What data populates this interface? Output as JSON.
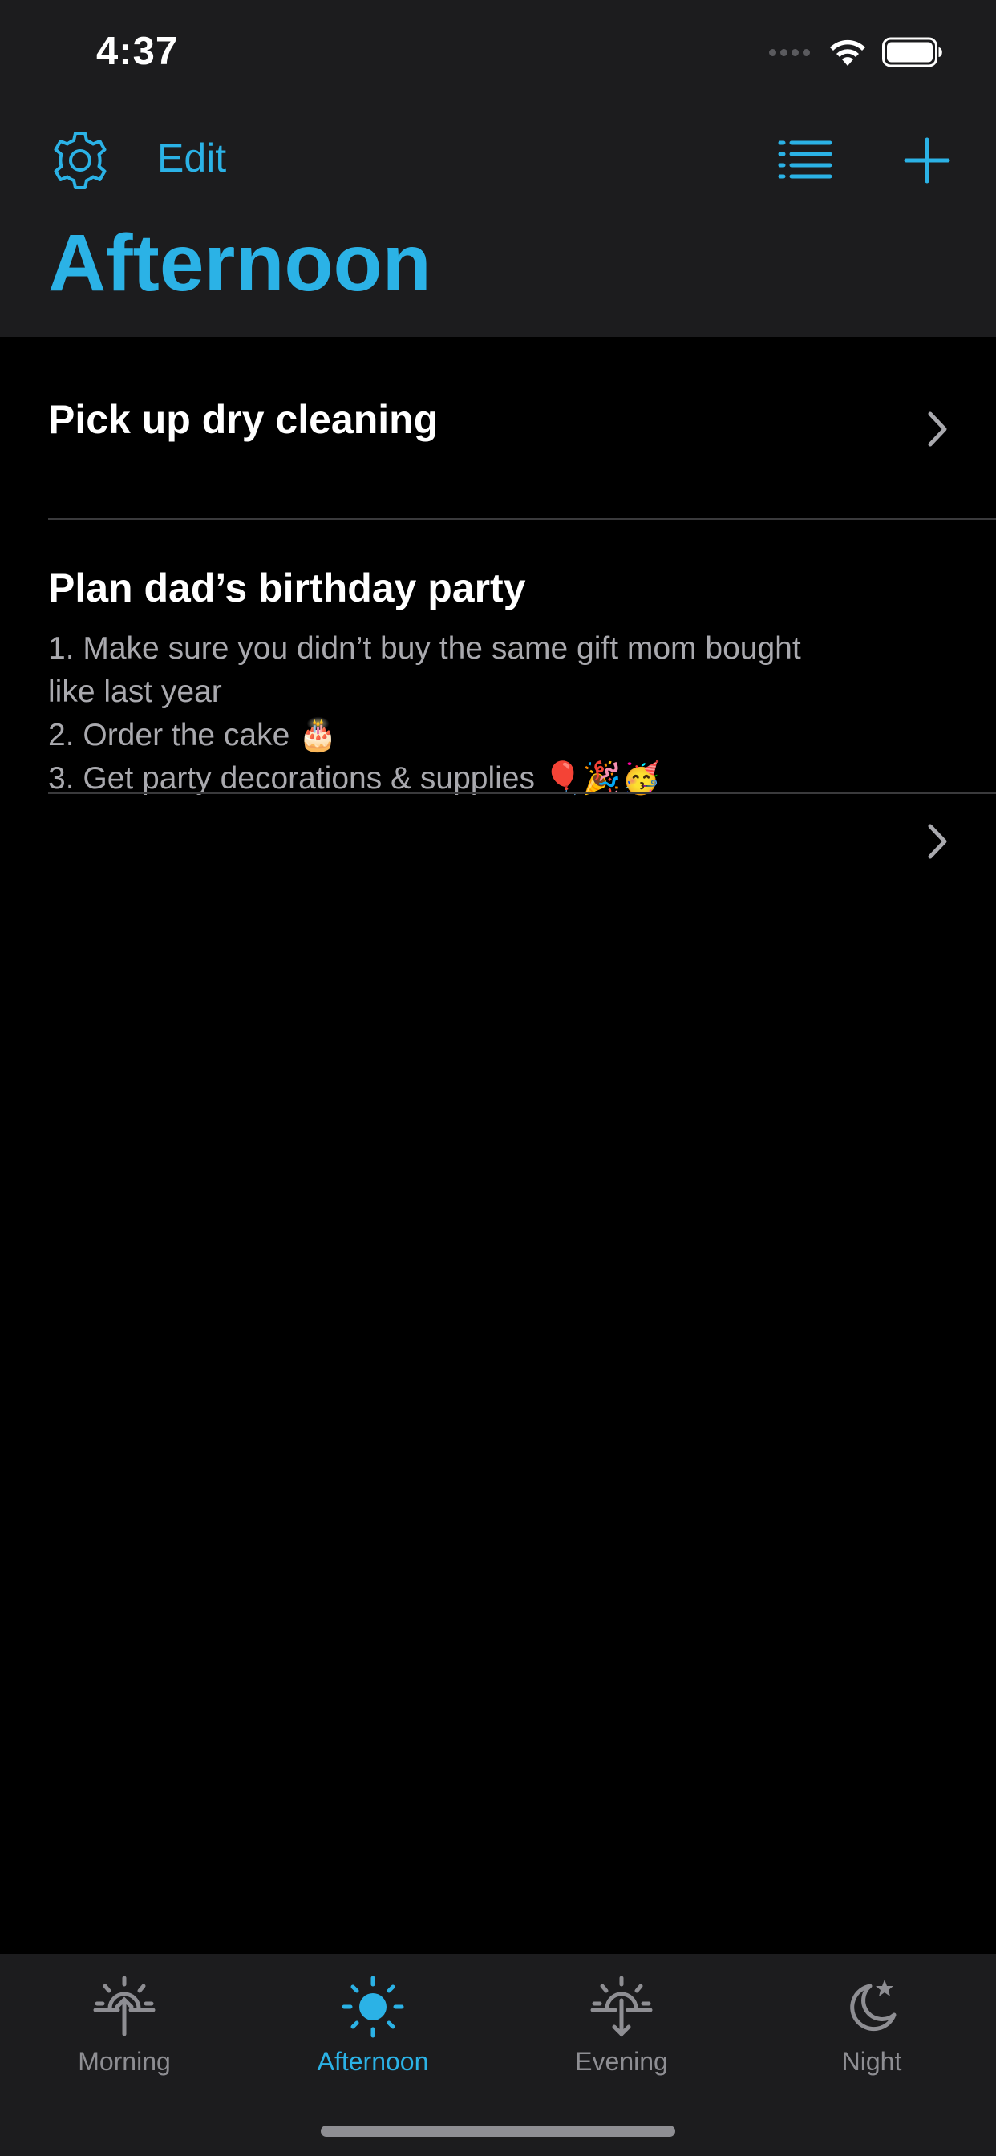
{
  "status_bar": {
    "time": "4:37"
  },
  "nav": {
    "edit_label": "Edit",
    "title": "Afternoon"
  },
  "tasks": [
    {
      "title": "Pick up dry cleaning"
    },
    {
      "title": "Plan dad’s birthday party",
      "notes": [
        "1. Make sure you didn’t buy the same gift mom bought",
        "like last year",
        "2. Order the cake 🎂",
        "3. Get party decorations & supplies 🎈🎉🥳"
      ]
    }
  ],
  "tabs": [
    {
      "label": "Morning",
      "icon": "sunrise-icon",
      "active": false
    },
    {
      "label": "Afternoon",
      "icon": "sun-icon",
      "active": true
    },
    {
      "label": "Evening",
      "icon": "sunset-icon",
      "active": false
    },
    {
      "label": "Night",
      "icon": "moon-star-icon",
      "active": false
    }
  ],
  "colors": {
    "accent": "#2bb2e6",
    "header_bg": "#1c1c1e",
    "background": "#000000",
    "secondary_text": "#a9a9ae",
    "inactive_tab": "#8e8e93"
  }
}
